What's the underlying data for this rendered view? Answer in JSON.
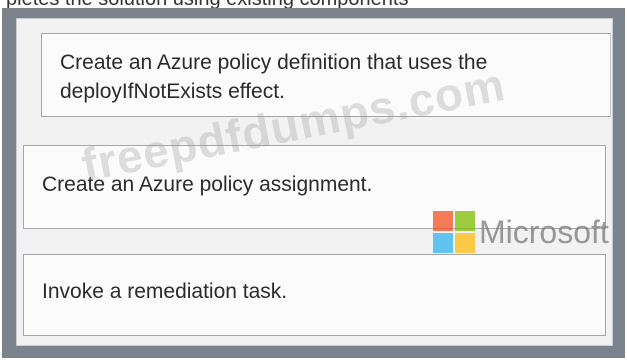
{
  "header_fragment": "pletes the solution using existing components",
  "steps": [
    {
      "text": "Create an Azure policy definition that uses the deployIfNotExists effect."
    },
    {
      "text": "Create an Azure policy assignment."
    },
    {
      "text": "Invoke a remediation task."
    }
  ],
  "watermark": {
    "text": "freepdfdumps.com",
    "brand_word": "Microsoft"
  },
  "colors": {
    "frame": "#7a828c",
    "panel": "#f2f2f2",
    "box_border": "#a4a8ad",
    "text": "#2b2b2b"
  }
}
